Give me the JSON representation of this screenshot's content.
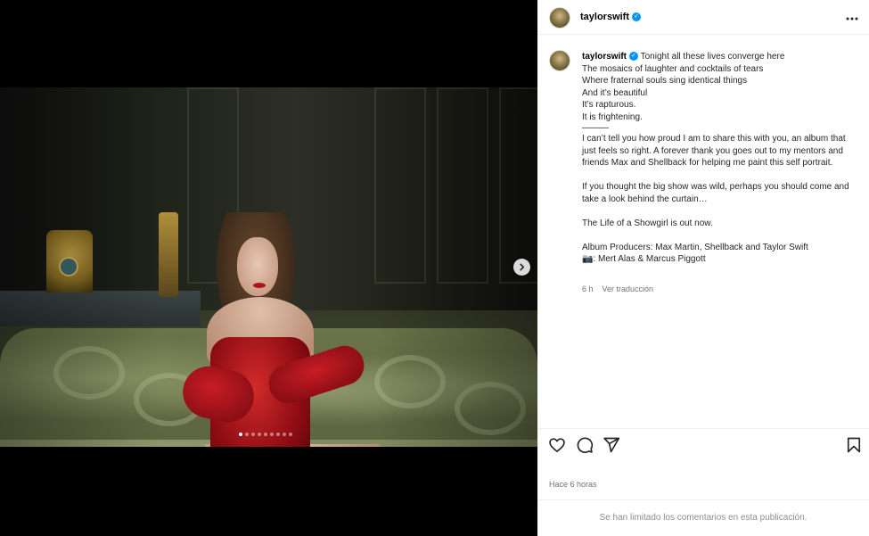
{
  "post": {
    "username": "taylorswift",
    "verified_mark": "✓",
    "more_icon": "more-horizontal-icon",
    "caption_lines": [
      "Tonight all these lives converge here",
      "The mosaics of laughter and cocktails of tears",
      "Where fraternal souls sing identical things",
      "And it’s beautiful",
      "It’s rapturous.",
      "It is frightening.",
      "———",
      "I can’t tell you how proud I am to share this with you, an album that just feels so right. A forever thank you goes out to my mentors and friends Max and Shellback for helping me paint this self portrait.",
      "",
      "If you thought the big show was wild, perhaps you should come and take a look behind the curtain…",
      "",
      "The Life of a Showgirl is out now.",
      "",
      "Album Producers: Max Martin, Shellback and Taylor Swift",
      "📷: Mert Alas & Marcus Piggott"
    ],
    "caption_time": "6 h",
    "see_translation": "Ver traducción",
    "time_ago": "Hace 6 horas",
    "comments_limited": "Se han limitado los comentarios en esta publicación."
  },
  "carousel": {
    "slide_count": 9,
    "active_slide": 1
  },
  "icons": {
    "like": "heart-icon",
    "comment": "comment-icon",
    "share": "send-icon",
    "save": "bookmark-icon",
    "next": "chevron-right-icon"
  }
}
